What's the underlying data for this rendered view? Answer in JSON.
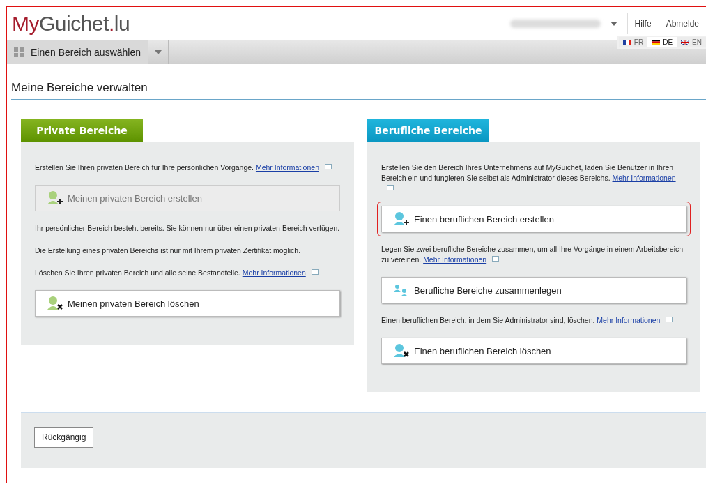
{
  "header": {
    "logo": {
      "brand": "MyGuichet",
      "dot": ".",
      "suffix": "lu"
    },
    "menu": [
      {
        "label": "Hilfe"
      },
      {
        "label": "Abmelde"
      }
    ]
  },
  "languages": [
    {
      "code": "FR",
      "kind": "fr",
      "selected": false
    },
    {
      "code": "DE",
      "kind": "de",
      "selected": true
    },
    {
      "code": "EN",
      "kind": "en",
      "selected": false
    }
  ],
  "nav": {
    "label": "Einen Bereich auswählen"
  },
  "page_title": "Meine Bereiche verwalten",
  "panels": [
    {
      "title": "Private Bereiche",
      "kind": "private",
      "blocks": [
        {
          "kind": "text",
          "text": "Erstellen Sie Ihren privaten Bereich für Ihre persönlichen Vorgänge.",
          "link": "Mehr Informationen"
        },
        {
          "kind": "create",
          "label": "Meinen privaten Bereich erstellen",
          "disabled": true,
          "highlighted": false
        },
        {
          "kind": "text",
          "text": "Ihr persönlicher Bereich besteht bereits. Sie können nur über einen privaten Bereich verfügen."
        },
        {
          "kind": "text",
          "text": "Die Erstellung eines privaten Bereichs ist nur mit Ihrem privaten Zertifikat möglich."
        },
        {
          "kind": "text",
          "text": "Löschen Sie Ihren privaten Bereich und alle seine Bestandteile.",
          "link": "Mehr Informationen"
        },
        {
          "kind": "delete",
          "label": "Meinen privaten Bereich löschen",
          "disabled": false,
          "highlighted": false
        }
      ]
    },
    {
      "title": "Berufliche Bereiche",
      "kind": "business",
      "blocks": [
        {
          "kind": "text",
          "text": "Erstellen Sie den Bereich Ihres Unternehmens auf MyGuichet, laden Sie Benutzer in Ihren Bereich ein und fungieren Sie selbst als Administrator dieses Bereichs.",
          "link": "Mehr Informationen"
        },
        {
          "kind": "create",
          "label": "Einen beruflichen Bereich erstellen",
          "disabled": false,
          "highlighted": true
        },
        {
          "kind": "text",
          "text": "Legen Sie zwei berufliche Bereiche zusammen, um all Ihre Vorgänge in einem Arbeitsbereich zu vereinen.",
          "link": "Mehr Informationen"
        },
        {
          "kind": "merge",
          "label": "Berufliche Bereiche zusammenlegen",
          "disabled": false,
          "highlighted": false
        },
        {
          "kind": "text",
          "text": "Einen beruflichen Bereich, in dem Sie Administrator sind, löschen.",
          "link": "Mehr Informationen"
        },
        {
          "kind": "delete",
          "label": "Einen beruflichen Bereich löschen",
          "disabled": false,
          "highlighted": false
        }
      ]
    }
  ],
  "footer": {
    "button": "Rückgängig"
  }
}
